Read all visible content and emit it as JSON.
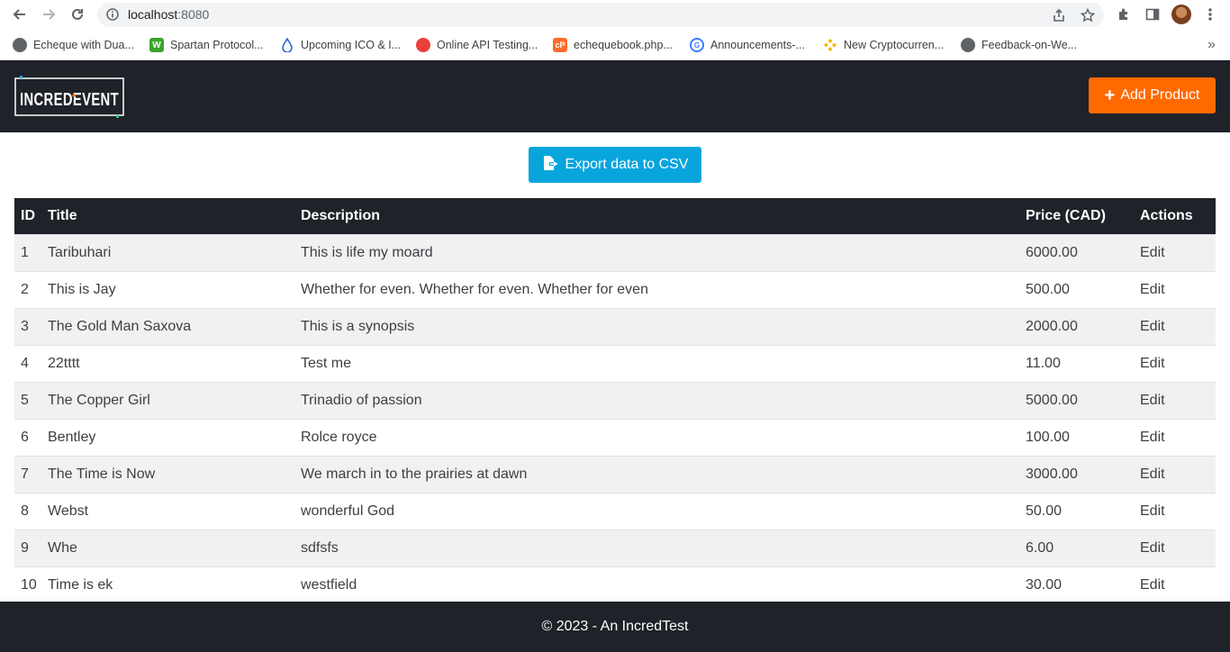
{
  "browser": {
    "url_host": "localhost",
    "url_port": ":8080",
    "bookmarks": [
      {
        "label": "Echeque with Dua...",
        "color": "#5f6368"
      },
      {
        "label": "Spartan Protocol...",
        "color": "#3aa52a"
      },
      {
        "label": "Upcoming ICO & I...",
        "color": "#2a6bd6"
      },
      {
        "label": "Online API Testing...",
        "color": "#e8413c"
      },
      {
        "label": "echequebook.php...",
        "color": "#ff6c2c"
      },
      {
        "label": "Announcements-...",
        "color": "#3b7cff"
      },
      {
        "label": "New Cryptocurren...",
        "color": "#f0b90b"
      },
      {
        "label": "Feedback-on-We...",
        "color": "#5f6368"
      }
    ]
  },
  "header": {
    "logo_text": "INCREDEVENT",
    "add_button": "Add Product"
  },
  "export_button": "Export data to CSV",
  "table": {
    "headers": [
      "ID",
      "Title",
      "Description",
      "Price (CAD)",
      "Actions"
    ],
    "rows": [
      {
        "id": "1",
        "title": "Taribuhari",
        "description": "This is life my moard",
        "price": "6000.00",
        "action": "Edit"
      },
      {
        "id": "2",
        "title": "This is Jay",
        "description": "Whether for even. Whether for even. Whether for even",
        "price": "500.00",
        "action": "Edit"
      },
      {
        "id": "3",
        "title": "The Gold Man Saxova",
        "description": "This is a synopsis",
        "price": "2000.00",
        "action": "Edit"
      },
      {
        "id": "4",
        "title": "22tttt",
        "description": "Test me",
        "price": "11.00",
        "action": "Edit"
      },
      {
        "id": "5",
        "title": "The Copper Girl",
        "description": "Trinadio of passion",
        "price": "5000.00",
        "action": "Edit"
      },
      {
        "id": "6",
        "title": "Bentley",
        "description": "Rolce royce",
        "price": "100.00",
        "action": "Edit"
      },
      {
        "id": "7",
        "title": "The Time is Now",
        "description": "We march in to the prairies at dawn",
        "price": "3000.00",
        "action": "Edit"
      },
      {
        "id": "8",
        "title": "Webst",
        "description": "wonderful God",
        "price": "50.00",
        "action": "Edit"
      },
      {
        "id": "9",
        "title": "Whe",
        "description": "sdfsfs",
        "price": "6.00",
        "action": "Edit"
      },
      {
        "id": "10",
        "title": "Time is ek",
        "description": "westfield",
        "price": "30.00",
        "action": "Edit"
      }
    ]
  },
  "footer": {
    "text": "© 2023 - An IncredTest"
  },
  "colors": {
    "header_bg": "#1f2228",
    "add_button": "#ff6a00",
    "export_button": "#08a5dd"
  }
}
